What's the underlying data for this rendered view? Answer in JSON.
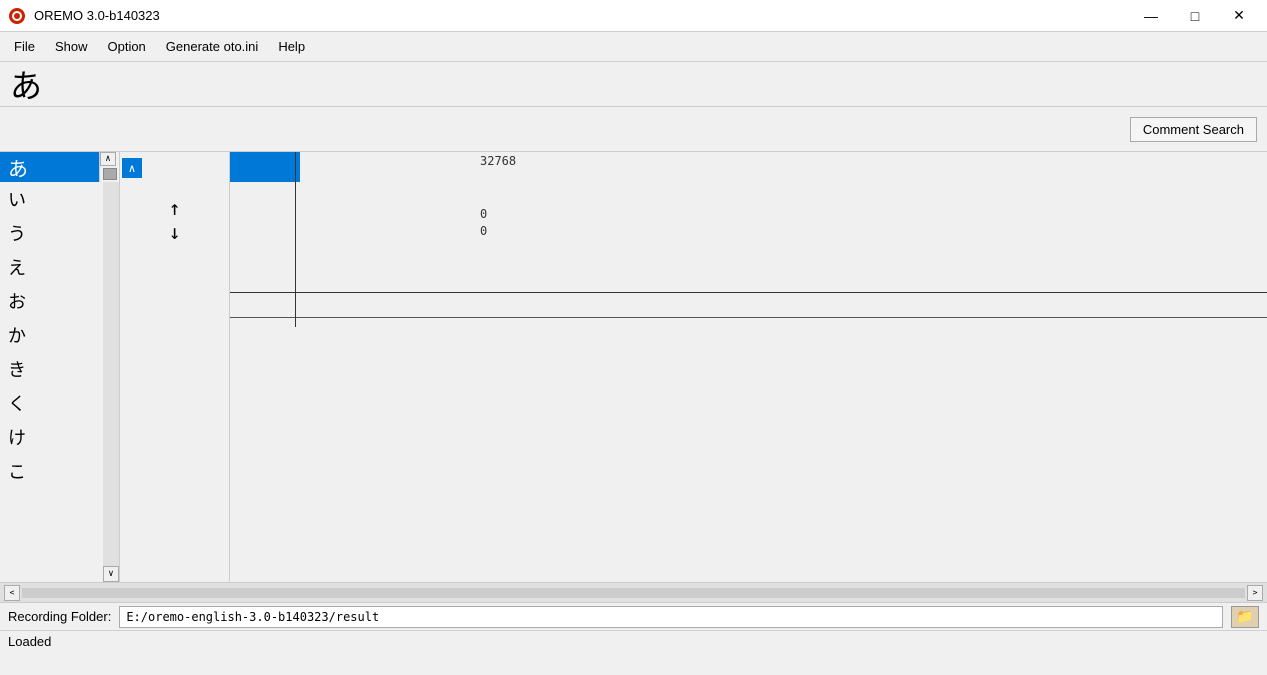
{
  "titleBar": {
    "icon": "♦",
    "title": "OREMO 3.0-b140323",
    "minimize": "—",
    "maximize": "□",
    "close": "✕"
  },
  "menuBar": {
    "items": [
      "File",
      "Show",
      "Option",
      "Generate oto.ini",
      "Help"
    ]
  },
  "kanaDisplay": {
    "character": "あ"
  },
  "toolbar": {
    "commentSearchLabel": "Comment Search"
  },
  "listPanel": {
    "items": [
      "あ",
      "い",
      "う",
      "え",
      "お",
      "か",
      "き",
      "く",
      "け",
      "こ"
    ],
    "selectedIndex": 0,
    "scrollUpLabel": "∧",
    "scrollDownLabel": "∨"
  },
  "controls": {
    "topLabel": "∧",
    "upArrow": "↑",
    "downArrow": "↓"
  },
  "waveform": {
    "number": "32768",
    "zero1": "0",
    "zero2": "0"
  },
  "statusBar": {
    "recordingFolderLabel": "Recording Folder:",
    "folderPath": "E:/oremo-english-3.0-b140323/result",
    "folderBtnIcon": "📁"
  },
  "statusLine": {
    "text": "Loaded"
  }
}
